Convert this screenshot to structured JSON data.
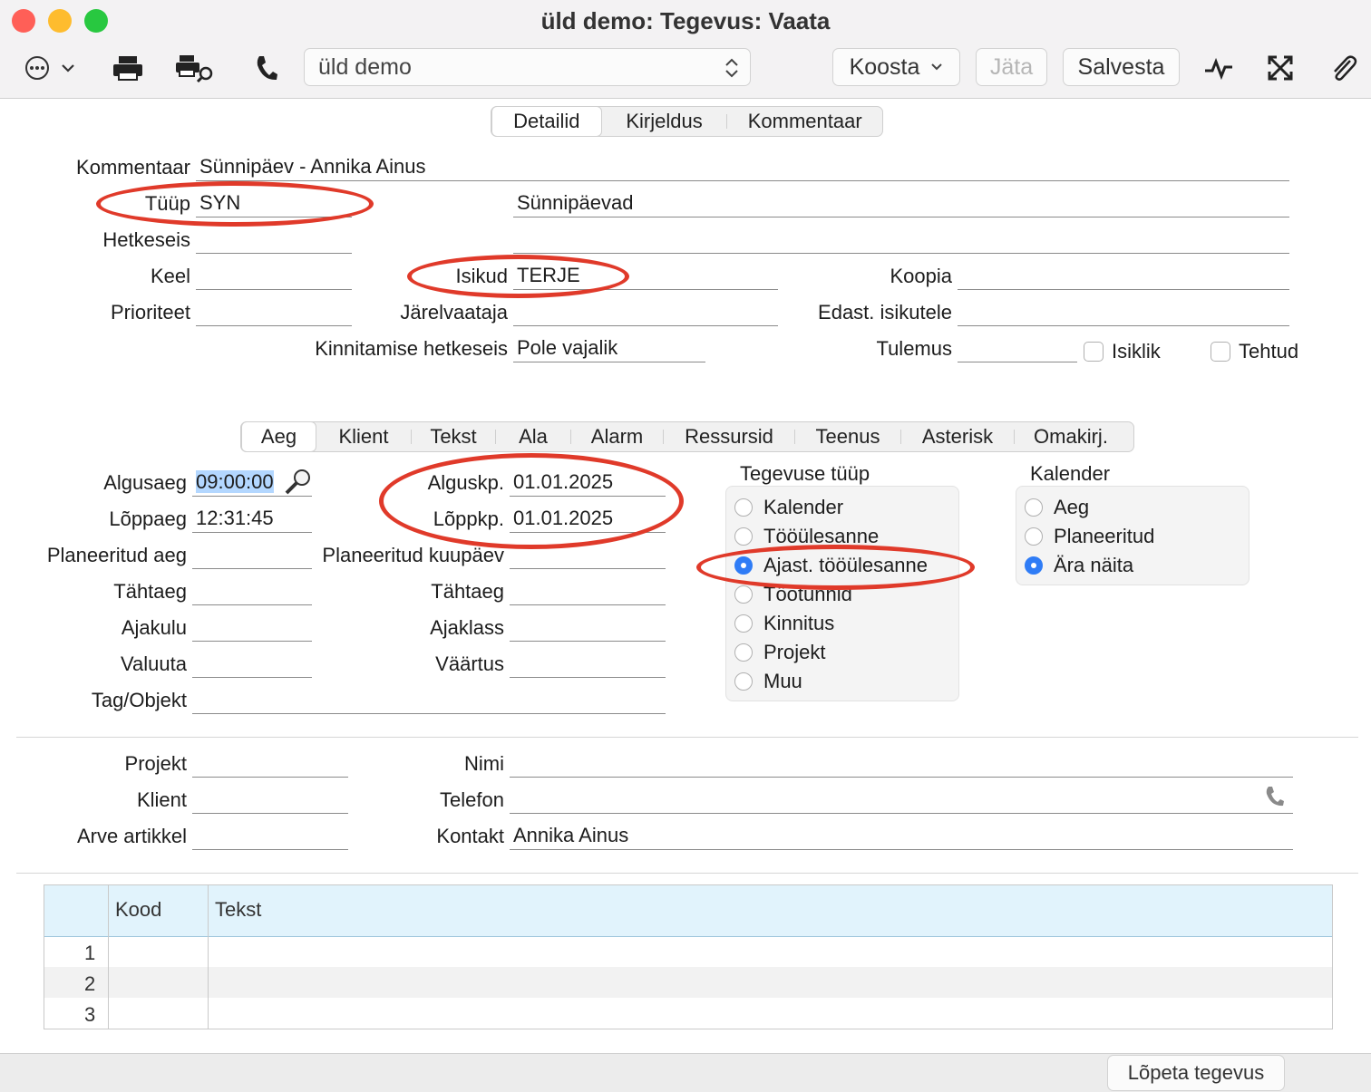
{
  "window": {
    "title": "üld demo: Tegevus: Vaata"
  },
  "toolbar": {
    "company_select": "üld demo",
    "koosta_label": "Koosta",
    "jata_label": "Jäta",
    "salvesta_label": "Salvesta",
    "icons": [
      "more-icon",
      "chevron-down-icon",
      "print-icon",
      "print-preview-icon",
      "phone-icon",
      "activity-icon",
      "expand-icon",
      "paperclip-icon"
    ]
  },
  "top_tabs": [
    "Detailid",
    "Kirjeldus",
    "Kommentaar"
  ],
  "header": {
    "kommentaar_label": "Kommentaar",
    "kommentaar_value": "Sünnipäev - Annika Ainus",
    "tuup_label": "Tüüp",
    "tuup_value": "SYN",
    "tuup_desc": "Sünnipäevad",
    "hetkeseis_label": "Hetkeseis",
    "keel_label": "Keel",
    "isikud_label": "Isikud",
    "isikud_value": "TERJE",
    "koopia_label": "Koopia",
    "prioriteet_label": "Prioriteet",
    "jarelvaataja_label": "Järelvaataja",
    "edast_label": "Edast. isikutele",
    "kinnitamise_label": "Kinnitamise hetkeseis",
    "kinnitamise_value": "Pole vajalik",
    "tulemus_label": "Tulemus",
    "isiklik_label": "Isiklik",
    "tehtud_label": "Tehtud"
  },
  "sub_tabs": [
    "Aeg",
    "Klient",
    "Tekst",
    "Ala",
    "Alarm",
    "Ressursid",
    "Teenus",
    "Asterisk",
    "Omakirj."
  ],
  "aeg": {
    "algusaeg_label": "Algusaeg",
    "algusaeg_value": "09:00:00",
    "loppaeg_label": "Lõppaeg",
    "loppaeg_value": "12:31:45",
    "planeeritud_aeg_label": "Planeeritud aeg",
    "tahtaeg_label": "Tähtaeg",
    "ajakulu_label": "Ajakulu",
    "valuuta_label": "Valuuta",
    "tag_label": "Tag/Objekt",
    "alguskp_label": "Alguskp.",
    "alguskp_value": "01.01.2025",
    "loppkp_label": "Lõppkp.",
    "loppkp_value": "01.01.2025",
    "planeeritud_kuupaev_label": "Planeeritud kuupäev",
    "tahtaeg2_label": "Tähtaeg",
    "ajaklass_label": "Ajaklass",
    "vaartus_label": "Väärtus"
  },
  "tegevuse_tuup": {
    "title": "Tegevuse tüüp",
    "options": [
      "Kalender",
      "Tööülesanne",
      "Ajast. tööülesanne",
      "Töötunnid",
      "Kinnitus",
      "Projekt",
      "Muu"
    ],
    "selected": "Ajast. tööülesanne"
  },
  "kalender": {
    "title": "Kalender",
    "options": [
      "Aeg",
      "Planeeritud",
      "Ära näita"
    ],
    "selected": "Ära näita"
  },
  "project": {
    "projekt_label": "Projekt",
    "klient_label": "Klient",
    "arve_label": "Arve artikkel",
    "nimi_label": "Nimi",
    "telefon_label": "Telefon",
    "kontakt_label": "Kontakt",
    "kontakt_value": "Annika Ainus"
  },
  "table": {
    "columns": [
      "Kood",
      "Tekst"
    ],
    "rows": [
      "1",
      "2",
      "3"
    ]
  },
  "footer": {
    "lopeta_label": "Lõpeta tegevus"
  },
  "colors": {
    "annotation": "#e03a2a",
    "radio_selected": "#2f7cf6",
    "table_header": "#e1f3fc"
  }
}
